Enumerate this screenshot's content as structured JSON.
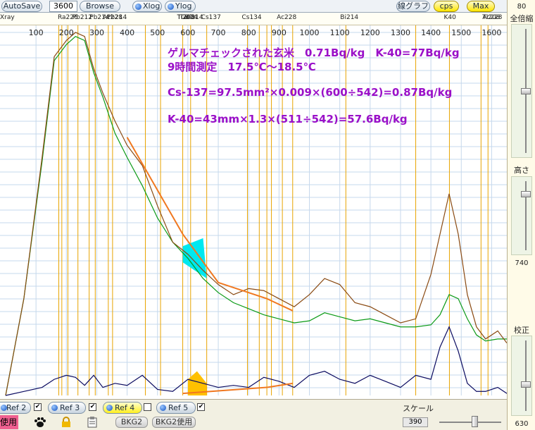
{
  "toolbar": {
    "autosave": "AutoSave",
    "time_value": "3600",
    "browse": "Browse",
    "xlog": "Xlog",
    "ylog": "Ylog",
    "line_graph": "線グラフ",
    "cps": "cps",
    "max": "Max"
  },
  "right_panel": {
    "top_value": "80",
    "zoom_label": "全倍縮",
    "height_label": "高さ",
    "height_value": "740",
    "calib_label": "校正",
    "bottom_value": "630"
  },
  "bottom_bar": {
    "use_label": "使用",
    "ref2": "Ref 2",
    "ref3": "Ref 3",
    "ref4": "Ref 4",
    "ref5": "Ref 5",
    "bkg2": "BKG2",
    "bkg2_use": "BKG2使用",
    "scale_label": "スケール",
    "scale_value": "390"
  },
  "colors": {
    "plot_bg": "#ffffff",
    "grid": "#c6d8ec",
    "green_series": "#0b9a16",
    "brown_series": "#8a4a12",
    "navy_series": "#0a0a60",
    "markers": "#e8a400",
    "annotation_text": "#9a10c8",
    "fit_lines": "#f07820",
    "roi_cyan": "#00e8f0",
    "roi_yellow": "#ffc000"
  },
  "chart_data": {
    "type": "line",
    "xlim": [
      0,
      1650
    ],
    "x_ticks": [
      "100",
      "200",
      "300",
      "400",
      "500",
      "600",
      "700",
      "800",
      "900",
      "1000",
      "1100",
      "1200",
      "1300",
      "1400",
      "1500",
      "1600"
    ],
    "x_tick_values": [
      100,
      200,
      300,
      400,
      500,
      600,
      700,
      800,
      900,
      1000,
      1100,
      1200,
      1300,
      1400,
      1500,
      1600
    ],
    "marker_labels": [
      {
        "text": "Xray",
        "x": 0
      },
      {
        "text": "Ra226",
        "x": 190
      },
      {
        "text": "Pb212",
        "x": 238
      },
      {
        "text": "Pb214",
        "x": 295
      },
      {
        "text": "Ac228",
        "x": 338
      },
      {
        "text": "Pb214",
        "x": 352
      },
      {
        "text": "Ge74",
        "x": 595
      },
      {
        "text": "Tl208",
        "x": 583
      },
      {
        "text": "Ti208",
        "x": 583
      },
      {
        "text": "Bi214",
        "x": 609
      },
      {
        "text": "Cs137",
        "x": 662
      },
      {
        "text": "Cs134",
        "x": 796
      },
      {
        "text": "Ac228",
        "x": 911
      },
      {
        "text": "Bi214",
        "x": 1120
      },
      {
        "text": "K40",
        "x": 1461
      },
      {
        "text": "Tl208",
        "x": 1588
      },
      {
        "text": "Ac228",
        "x": 1588
      }
    ],
    "marker_lines_x": [
      175,
      185,
      205,
      238,
      275,
      295,
      338,
      352,
      460,
      510,
      583,
      609,
      662,
      796,
      835,
      860,
      875,
      911,
      945,
      1120,
      1350,
      1461,
      1565,
      1588
    ],
    "annotations": [
      "ゲルマチェックされた玄米　0.71Bq/kg　K-40=77Bq/kg",
      "9時間測定　17.5℃～18.5℃",
      "Cs-137=97.5mm²×0.009×(600÷542)=0.87Bq/kg",
      "K-40=43mm×1.3×(511÷542)=57.6Bq/kg"
    ],
    "series": [
      {
        "color": "#0b9a16",
        "x": [
          0,
          60,
          120,
          160,
          200,
          230,
          260,
          290,
          320,
          360,
          400,
          450,
          500,
          550,
          600,
          650,
          700,
          750,
          800,
          850,
          900,
          950,
          1000,
          1050,
          1100,
          1150,
          1200,
          1250,
          1300,
          1350,
          1400,
          1430,
          1460,
          1490,
          1520,
          1550,
          1580,
          1620,
          1650
        ],
        "y": [
          0,
          240,
          580,
          830,
          870,
          890,
          880,
          800,
          740,
          650,
          590,
          520,
          440,
          380,
          340,
          290,
          255,
          230,
          215,
          200,
          190,
          180,
          185,
          205,
          195,
          185,
          190,
          180,
          170,
          170,
          175,
          200,
          250,
          240,
          190,
          150,
          135,
          140,
          140
        ]
      },
      {
        "color": "#8a4a12",
        "x": [
          0,
          60,
          120,
          160,
          200,
          230,
          260,
          290,
          320,
          360,
          400,
          450,
          500,
          550,
          600,
          650,
          700,
          750,
          800,
          850,
          900,
          950,
          1000,
          1050,
          1100,
          1150,
          1200,
          1250,
          1300,
          1350,
          1400,
          1430,
          1460,
          1490,
          1520,
          1550,
          1580,
          1620,
          1650
        ],
        "y": [
          0,
          240,
          590,
          840,
          880,
          900,
          890,
          810,
          750,
          680,
          620,
          570,
          470,
          380,
          350,
          310,
          275,
          250,
          265,
          260,
          240,
          220,
          250,
          290,
          275,
          230,
          220,
          200,
          180,
          190,
          300,
          400,
          500,
          400,
          250,
          170,
          140,
          160,
          130
        ]
      },
      {
        "color": "#0a0a60",
        "x": [
          0,
          60,
          120,
          160,
          200,
          230,
          260,
          290,
          320,
          360,
          400,
          450,
          500,
          550,
          600,
          650,
          700,
          750,
          800,
          850,
          900,
          950,
          1000,
          1050,
          1100,
          1150,
          1200,
          1250,
          1300,
          1350,
          1400,
          1430,
          1460,
          1490,
          1520,
          1550,
          1580,
          1620,
          1650
        ],
        "y": [
          0,
          10,
          20,
          40,
          50,
          45,
          25,
          50,
          20,
          30,
          25,
          50,
          15,
          10,
          40,
          30,
          20,
          25,
          20,
          45,
          35,
          20,
          50,
          60,
          40,
          30,
          50,
          35,
          20,
          50,
          40,
          120,
          170,
          110,
          30,
          10,
          10,
          20,
          5
        ]
      }
    ]
  }
}
